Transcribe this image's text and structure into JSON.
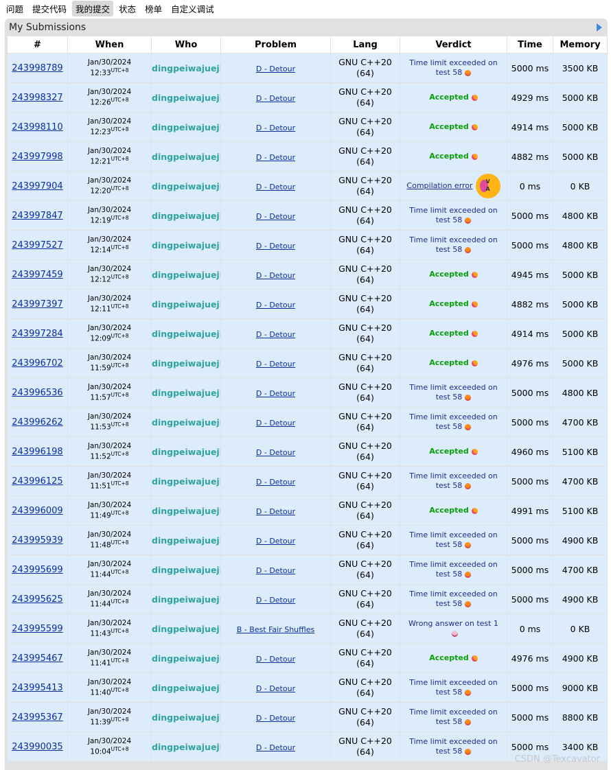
{
  "nav": {
    "items": [
      "问题",
      "提交代码",
      "我的提交",
      "状态",
      "榜单",
      "自定义调试"
    ],
    "active_index": 2
  },
  "panel": {
    "title": "My Submissions"
  },
  "table": {
    "headers": [
      "#",
      "When",
      "Who",
      "Problem",
      "Lang",
      "Verdict",
      "Time",
      "Memory"
    ],
    "rows": [
      {
        "id": "243998789",
        "date": "Jan/30/2024",
        "time": "12:33",
        "tz": "UTC+8",
        "who": "dingpeiwajueji",
        "problem": "D - Detour",
        "lang1": "GNU C++20",
        "lang2": "(64)",
        "verdict1": "Time limit exceeded on",
        "verdict2": "test 58",
        "vtype": "tle",
        "run": "5000 ms",
        "mem": "3500 KB"
      },
      {
        "id": "243998327",
        "date": "Jan/30/2024",
        "time": "12:26",
        "tz": "UTC+8",
        "who": "dingpeiwajueji",
        "problem": "D - Detour",
        "lang1": "GNU C++20",
        "lang2": "(64)",
        "verdict1": "Accepted",
        "verdict2": "",
        "vtype": "ac",
        "run": "4929 ms",
        "mem": "5000 KB"
      },
      {
        "id": "243998110",
        "date": "Jan/30/2024",
        "time": "12:23",
        "tz": "UTC+8",
        "who": "dingpeiwajueji",
        "problem": "D - Detour",
        "lang1": "GNU C++20",
        "lang2": "(64)",
        "verdict1": "Accepted",
        "verdict2": "",
        "vtype": "ac",
        "run": "4914 ms",
        "mem": "5000 KB"
      },
      {
        "id": "243997998",
        "date": "Jan/30/2024",
        "time": "12:21",
        "tz": "UTC+8",
        "who": "dingpeiwajueji",
        "problem": "D - Detour",
        "lang1": "GNU C++20",
        "lang2": "(64)",
        "verdict1": "Accepted",
        "verdict2": "",
        "vtype": "ac",
        "run": "4882 ms",
        "mem": "5000 KB"
      },
      {
        "id": "243997904",
        "date": "Jan/30/2024",
        "time": "12:20",
        "tz": "UTC+8",
        "who": "dingpeiwajueji",
        "problem": "D - Detour",
        "lang1": "GNU C++20",
        "lang2": "(64)",
        "verdict1": "Compilation error",
        "verdict2": "",
        "vtype": "ce",
        "run": "0 ms",
        "mem": "0 KB"
      },
      {
        "id": "243997847",
        "date": "Jan/30/2024",
        "time": "12:19",
        "tz": "UTC+8",
        "who": "dingpeiwajueji",
        "problem": "D - Detour",
        "lang1": "GNU C++20",
        "lang2": "(64)",
        "verdict1": "Time limit exceeded on",
        "verdict2": "test 58",
        "vtype": "tle",
        "run": "5000 ms",
        "mem": "4800 KB"
      },
      {
        "id": "243997527",
        "date": "Jan/30/2024",
        "time": "12:14",
        "tz": "UTC+8",
        "who": "dingpeiwajueji",
        "problem": "D - Detour",
        "lang1": "GNU C++20",
        "lang2": "(64)",
        "verdict1": "Time limit exceeded on",
        "verdict2": "test 58",
        "vtype": "tle",
        "run": "5000 ms",
        "mem": "4800 KB"
      },
      {
        "id": "243997459",
        "date": "Jan/30/2024",
        "time": "12:12",
        "tz": "UTC+8",
        "who": "dingpeiwajueji",
        "problem": "D - Detour",
        "lang1": "GNU C++20",
        "lang2": "(64)",
        "verdict1": "Accepted",
        "verdict2": "",
        "vtype": "ac",
        "run": "4945 ms",
        "mem": "5000 KB"
      },
      {
        "id": "243997397",
        "date": "Jan/30/2024",
        "time": "12:11",
        "tz": "UTC+8",
        "who": "dingpeiwajueji",
        "problem": "D - Detour",
        "lang1": "GNU C++20",
        "lang2": "(64)",
        "verdict1": "Accepted",
        "verdict2": "",
        "vtype": "ac",
        "run": "4882 ms",
        "mem": "5000 KB"
      },
      {
        "id": "243997284",
        "date": "Jan/30/2024",
        "time": "12:09",
        "tz": "UTC+8",
        "who": "dingpeiwajueji",
        "problem": "D - Detour",
        "lang1": "GNU C++20",
        "lang2": "(64)",
        "verdict1": "Accepted",
        "verdict2": "",
        "vtype": "ac",
        "run": "4914 ms",
        "mem": "5000 KB"
      },
      {
        "id": "243996702",
        "date": "Jan/30/2024",
        "time": "11:59",
        "tz": "UTC+8",
        "who": "dingpeiwajueji",
        "problem": "D - Detour",
        "lang1": "GNU C++20",
        "lang2": "(64)",
        "verdict1": "Accepted",
        "verdict2": "",
        "vtype": "ac",
        "run": "4976 ms",
        "mem": "5000 KB"
      },
      {
        "id": "243996536",
        "date": "Jan/30/2024",
        "time": "11:57",
        "tz": "UTC+8",
        "who": "dingpeiwajueji",
        "problem": "D - Detour",
        "lang1": "GNU C++20",
        "lang2": "(64)",
        "verdict1": "Time limit exceeded on",
        "verdict2": "test 58",
        "vtype": "tle",
        "run": "5000 ms",
        "mem": "4800 KB"
      },
      {
        "id": "243996262",
        "date": "Jan/30/2024",
        "time": "11:53",
        "tz": "UTC+8",
        "who": "dingpeiwajueji",
        "problem": "D - Detour",
        "lang1": "GNU C++20",
        "lang2": "(64)",
        "verdict1": "Time limit exceeded on",
        "verdict2": "test 58",
        "vtype": "tle",
        "run": "5000 ms",
        "mem": "4700 KB"
      },
      {
        "id": "243996198",
        "date": "Jan/30/2024",
        "time": "11:52",
        "tz": "UTC+8",
        "who": "dingpeiwajueji",
        "problem": "D - Detour",
        "lang1": "GNU C++20",
        "lang2": "(64)",
        "verdict1": "Accepted",
        "verdict2": "",
        "vtype": "ac",
        "run": "4960 ms",
        "mem": "5100 KB"
      },
      {
        "id": "243996125",
        "date": "Jan/30/2024",
        "time": "11:51",
        "tz": "UTC+8",
        "who": "dingpeiwajueji",
        "problem": "D - Detour",
        "lang1": "GNU C++20",
        "lang2": "(64)",
        "verdict1": "Time limit exceeded on",
        "verdict2": "test 58",
        "vtype": "tle",
        "run": "5000 ms",
        "mem": "4700 KB"
      },
      {
        "id": "243996009",
        "date": "Jan/30/2024",
        "time": "11:49",
        "tz": "UTC+8",
        "who": "dingpeiwajueji",
        "problem": "D - Detour",
        "lang1": "GNU C++20",
        "lang2": "(64)",
        "verdict1": "Accepted",
        "verdict2": "",
        "vtype": "ac",
        "run": "4991 ms",
        "mem": "5100 KB"
      },
      {
        "id": "243995939",
        "date": "Jan/30/2024",
        "time": "11:48",
        "tz": "UTC+8",
        "who": "dingpeiwajueji",
        "problem": "D - Detour",
        "lang1": "GNU C++20",
        "lang2": "(64)",
        "verdict1": "Time limit exceeded on",
        "verdict2": "test 58",
        "vtype": "tle",
        "run": "5000 ms",
        "mem": "4900 KB"
      },
      {
        "id": "243995699",
        "date": "Jan/30/2024",
        "time": "11:44",
        "tz": "UTC+8",
        "who": "dingpeiwajueji",
        "problem": "D - Detour",
        "lang1": "GNU C++20",
        "lang2": "(64)",
        "verdict1": "Time limit exceeded on",
        "verdict2": "test 58",
        "vtype": "tle",
        "run": "5000 ms",
        "mem": "4700 KB"
      },
      {
        "id": "243995625",
        "date": "Jan/30/2024",
        "time": "11:44",
        "tz": "UTC+8",
        "who": "dingpeiwajueji",
        "problem": "D - Detour",
        "lang1": "GNU C++20",
        "lang2": "(64)",
        "verdict1": "Time limit exceeded on",
        "verdict2": "test 58",
        "vtype": "tle",
        "run": "5000 ms",
        "mem": "4900 KB"
      },
      {
        "id": "243995599",
        "date": "Jan/30/2024",
        "time": "11:43",
        "tz": "UTC+8",
        "who": "dingpeiwajueji",
        "problem": "B - Best Fair Shuffles",
        "lang1": "GNU C++20",
        "lang2": "(64)",
        "verdict1": "Wrong answer on test 1",
        "verdict2": "",
        "vtype": "wa",
        "run": "0 ms",
        "mem": "0 KB"
      },
      {
        "id": "243995467",
        "date": "Jan/30/2024",
        "time": "11:41",
        "tz": "UTC+8",
        "who": "dingpeiwajueji",
        "problem": "D - Detour",
        "lang1": "GNU C++20",
        "lang2": "(64)",
        "verdict1": "Accepted",
        "verdict2": "",
        "vtype": "ac",
        "run": "4976 ms",
        "mem": "4900 KB"
      },
      {
        "id": "243995413",
        "date": "Jan/30/2024",
        "time": "11:40",
        "tz": "UTC+8",
        "who": "dingpeiwajueji",
        "problem": "D - Detour",
        "lang1": "GNU C++20",
        "lang2": "(64)",
        "verdict1": "Time limit exceeded on",
        "verdict2": "test 58",
        "vtype": "tle",
        "run": "5000 ms",
        "mem": "9000 KB"
      },
      {
        "id": "243995367",
        "date": "Jan/30/2024",
        "time": "11:39",
        "tz": "UTC+8",
        "who": "dingpeiwajueji",
        "problem": "D - Detour",
        "lang1": "GNU C++20",
        "lang2": "(64)",
        "verdict1": "Time limit exceeded on",
        "verdict2": "test 58",
        "vtype": "tle",
        "run": "5000 ms",
        "mem": "8800 KB"
      },
      {
        "id": "243990035",
        "date": "Jan/30/2024",
        "time": "10:04",
        "tz": "UTC+8",
        "who": "dingpeiwajueji",
        "problem": "D - Detour",
        "lang1": "GNU C++20",
        "lang2": "(64)",
        "verdict1": "Time limit exceeded on",
        "verdict2": "test 58",
        "vtype": "tle",
        "run": "5000 ms",
        "mem": "3400 KB"
      }
    ]
  },
  "colors": {
    "row_bg": "#dcecfa",
    "accepted": "#0a9e0a",
    "who": "#2fa39e",
    "link": "#0a2ea0"
  },
  "watermark": "CSDN @Texcavator"
}
